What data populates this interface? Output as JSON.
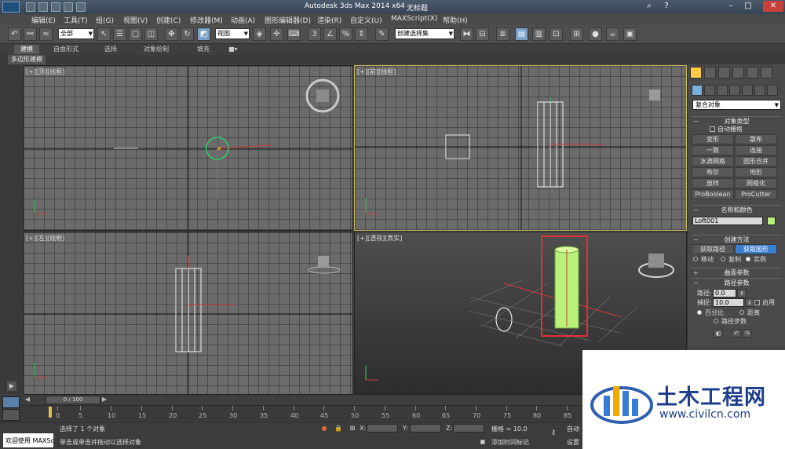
{
  "window": {
    "title": "Autodesk 3ds Max  2014 x64",
    "document": "无标题"
  },
  "menu": [
    "编辑(E)",
    "工具(T)",
    "组(G)",
    "视图(V)",
    "创建(C)",
    "修改器(M)",
    "动画(A)",
    "图形编辑器(D)",
    "渲染(R)",
    "自定义(U)",
    "MAXScript(X)",
    "帮助(H)"
  ],
  "toolbar": {
    "filter_select": "全部",
    "ref_coord_select": "视图",
    "named_selection": "创建选择集"
  },
  "ribbon": {
    "tabs": [
      "建模",
      "自由形式",
      "选择",
      "对象绘制",
      "填充"
    ],
    "active_tab": "建模",
    "sub_label": "多边形建模"
  },
  "viewports": {
    "top": "[+][顶][线框]",
    "front": "[+][前][线框]",
    "left": "[+][左][线框]",
    "perspective": "[+][透视][真实]"
  },
  "command_panel": {
    "category": "复合对象",
    "object_type": {
      "header": "对象类型",
      "autogrid": "自动栅格",
      "buttons": [
        "变形",
        "散布",
        "一致",
        "连接",
        "水滴网格",
        "图形合并",
        "布尔",
        "地形",
        "放样",
        "网格化",
        "ProBoolean",
        "ProCutter"
      ]
    },
    "name_color": {
      "header": "名称和颜色",
      "name": "Loft001",
      "color": "#b9f27a"
    },
    "creation_method": {
      "header": "创建方法",
      "get_path": "获取路径",
      "get_shape": "获取图形",
      "options": [
        "移动",
        "复制",
        "实例"
      ],
      "selected": "实例"
    },
    "surface_params": "曲面参数",
    "path_params": {
      "header": "路径参数",
      "path_label": "路径:",
      "path_value": "0.0",
      "snap_label": "捕捉:",
      "snap_value": "10.0",
      "enable": "启用",
      "percent": "百分比",
      "distance": "距离",
      "path_steps": "路径步数"
    }
  },
  "timeline": {
    "frame_display": "0 / 100",
    "ticks": [
      "0",
      "5",
      "10",
      "15",
      "20",
      "25",
      "30",
      "35",
      "40",
      "45",
      "50",
      "55",
      "60",
      "65",
      "70",
      "75",
      "80",
      "85"
    ]
  },
  "status": {
    "maxscript": "欢迎使用 MAXSc",
    "selection_info": "选择了 1 个对象",
    "prompt": "单击或单击并拖动以选择对象",
    "x_label": "X:",
    "y_label": "Y:",
    "z_label": "Z:",
    "grid": "栅格 = 10.0",
    "add_time_tag": "添加时间标记",
    "auto_key": "自动",
    "set_key": "设置"
  },
  "watermark": {
    "brand": "土木工程网",
    "url": "www.civilcn.com"
  }
}
